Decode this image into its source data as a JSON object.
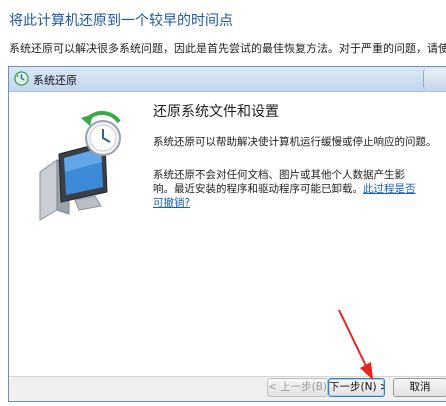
{
  "page": {
    "heading": "将此计算机还原到一个较早的时间点",
    "intro": "系统还原可以解决很多系统问题，因此是首先尝试的最佳恢复方法。对于严重的问题，请使用高级恢复方"
  },
  "dialog": {
    "title": "系统还原",
    "heading": "还原系统文件和设置",
    "paragraph1": "系统还原可以帮助解决使计算机运行缓慢或停止响应的问题。",
    "paragraph2": "系统还原不会对任何文档、图片或其他个人数据产生影响。最近安装的程序和驱动程序可能已卸载。",
    "link": "此过程是否可撤销?",
    "buttons": {
      "back": "< 上一步(B)",
      "next": "下一步(N) >",
      "cancel": "取消"
    }
  },
  "colors": {
    "heading_blue": "#1f57a8",
    "link_blue": "#1a5fb4",
    "annotation_red": "#e8221d"
  }
}
